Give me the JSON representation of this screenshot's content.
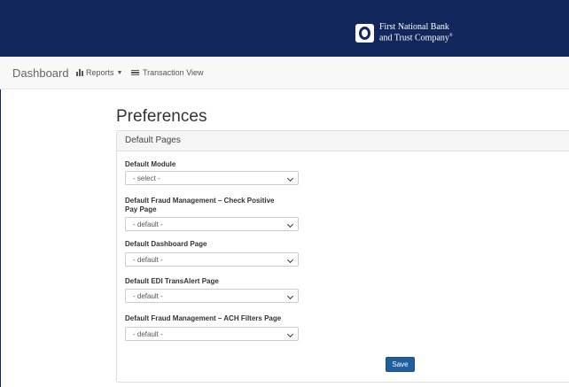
{
  "header": {
    "brand_line1": "First National Bank",
    "brand_line2": "and Trust Company",
    "brand_mark": "trademark",
    "logo_icon": "bank-logo-icon",
    "bg_color": "#12285d"
  },
  "nav": {
    "dashboard": "Dashboard",
    "reports": "Reports",
    "reports_icon": "bar-chart-icon",
    "transaction_view": "Transaction View",
    "transaction_icon": "list-icon"
  },
  "page": {
    "title": "Preferences"
  },
  "panel": {
    "heading": "Default Pages",
    "fields": [
      {
        "label": "Default Module",
        "value": "- select -"
      },
      {
        "label": "Default Fraud Management – Check Positive Pay Page",
        "value": "- default -"
      },
      {
        "label": "Default Dashboard Page",
        "value": "- default -"
      },
      {
        "label": "Default EDI TransAlert Page",
        "value": "- default -"
      },
      {
        "label": "Default Fraud Management – ACH Filters Page",
        "value": "- default -"
      }
    ],
    "save_label": "Save",
    "save_color": "#1f5f9e"
  }
}
